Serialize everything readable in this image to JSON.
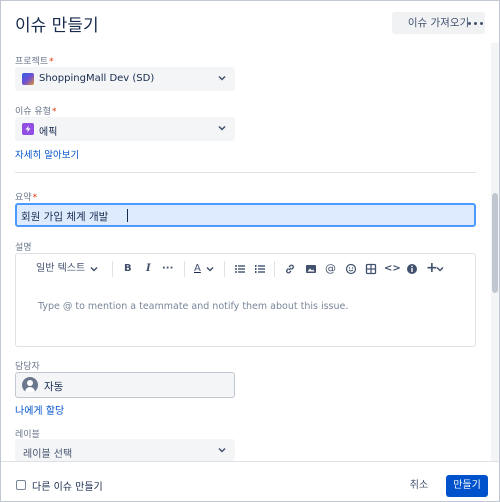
{
  "header": {
    "title": "이슈 만들기",
    "import_label": "이슈 가져오기"
  },
  "form": {
    "project": {
      "label": "프로젝트",
      "required_mark": "*",
      "value": "ShoppingMall Dev (SD)"
    },
    "issue_type": {
      "label": "이슈 유형",
      "required_mark": "*",
      "value": "에픽",
      "learn_more": "자세히 알아보기"
    },
    "summary": {
      "label": "요약",
      "required_mark": "*",
      "value": "회원 가입 체계 개발"
    },
    "description": {
      "label": "설명",
      "text_style": "일반 텍스트",
      "placeholder": "Type @ to mention a teammate and notify them about this issue."
    },
    "assignee": {
      "label": "담당자",
      "value": "자동",
      "assign_to_me": "나에게 할당"
    },
    "labels": {
      "label": "레이블",
      "placeholder": "레이블 선택"
    }
  },
  "footer": {
    "create_another": "다른 이슈 만들기",
    "create_another_checked": false,
    "cancel_label": "취소",
    "create_label": "만들기"
  },
  "colors": {
    "primary": "#0052cc",
    "focus_border": "#4c9aff",
    "required": "#de350b",
    "epic": "#904ee2"
  }
}
